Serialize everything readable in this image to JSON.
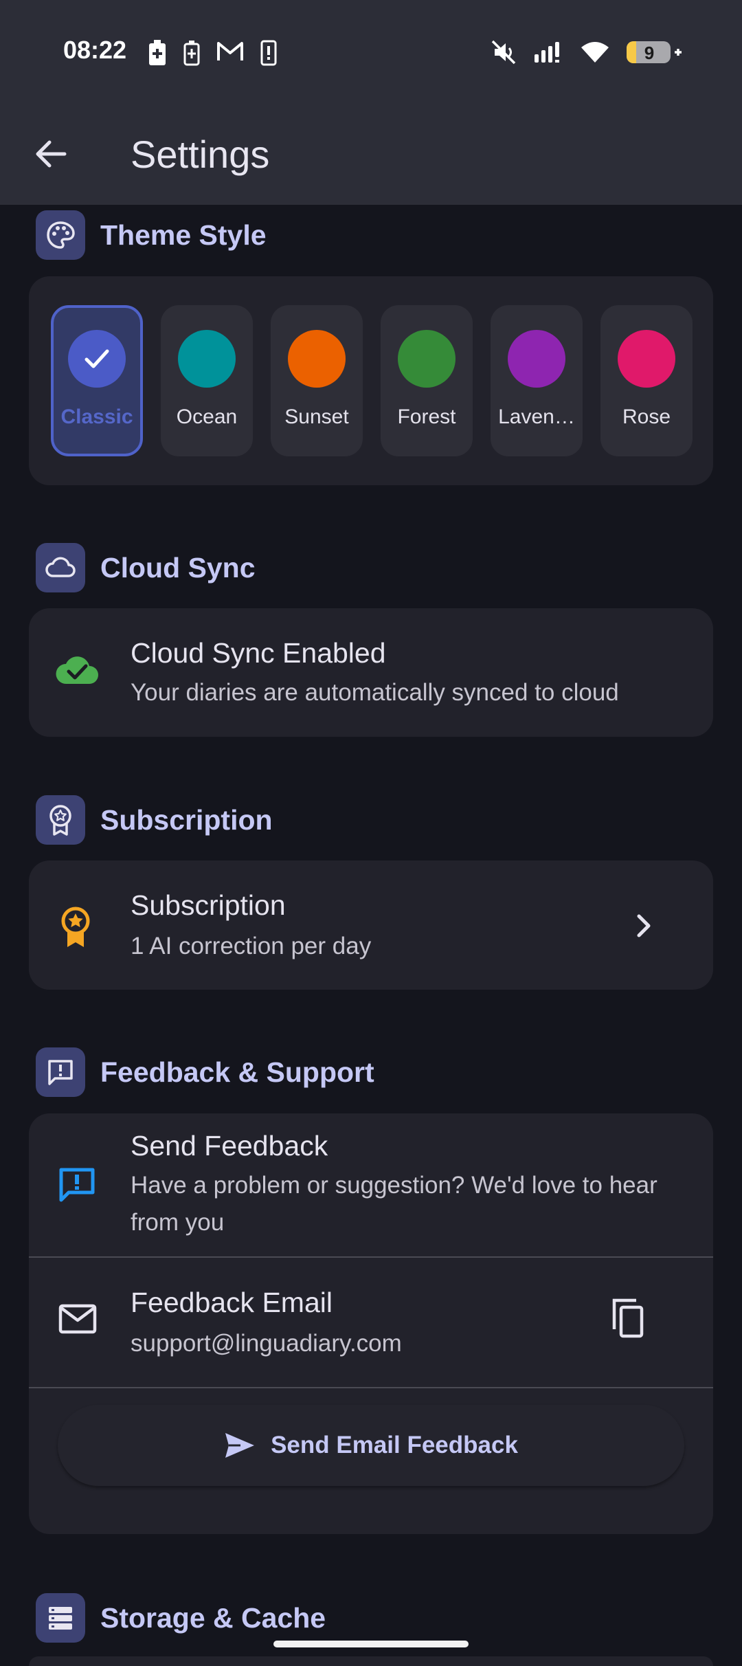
{
  "status_bar": {
    "time": "08:22",
    "battery_level": "9"
  },
  "app_bar": {
    "title": "Settings"
  },
  "sections": {
    "theme": {
      "title": "Theme Style"
    },
    "cloud": {
      "title": "Cloud Sync"
    },
    "subscription": {
      "title": "Subscription"
    },
    "feedback": {
      "title": "Feedback & Support"
    },
    "storage": {
      "title": "Storage & Cache"
    }
  },
  "themes": [
    {
      "label": "Classic",
      "color": "#4b5bc7",
      "selected": true
    },
    {
      "label": "Ocean",
      "color": "#00929a"
    },
    {
      "label": "Sunset",
      "color": "#eb6100"
    },
    {
      "label": "Forest",
      "color": "#358b38"
    },
    {
      "label": "Laven…",
      "color": "#8e25b0"
    },
    {
      "label": "Rose",
      "color": "#e0196a"
    }
  ],
  "cloud_sync": {
    "title": "Cloud Sync Enabled",
    "subtitle": "Your diaries are automatically synced to cloud"
  },
  "subscription": {
    "title": "Subscription",
    "subtitle": "1 AI correction per day"
  },
  "feedback": {
    "send_title": "Send Feedback",
    "send_subtitle": "Have a problem or suggestion? We'd love to hear from you",
    "email_title": "Feedback Email",
    "email_value": "support@linguadiary.com",
    "email_button": "Send Email Feedback"
  },
  "colors": {
    "accent": "#c5c8f5",
    "success": "#4caf50",
    "warning": "#f5a623",
    "info": "#2196f3"
  }
}
